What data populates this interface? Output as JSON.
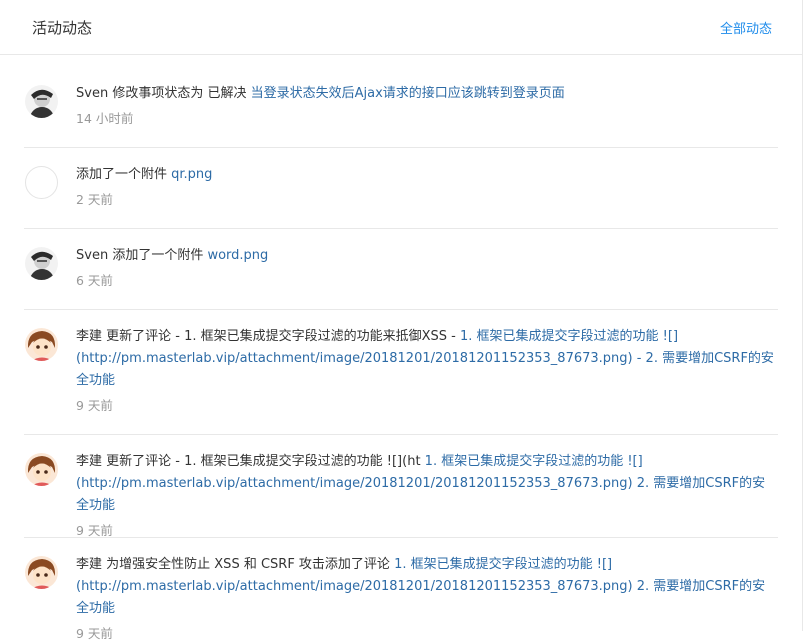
{
  "header": {
    "title": "活动动态",
    "all_link": "全部动态"
  },
  "activities": [
    {
      "actor": "Sven",
      "action": " 修改事项状态为 已解决 ",
      "target": "当登录状态失效后Ajax请求的接口应该跳转到登录页面",
      "time": "14 小时前",
      "avatar": "avatar-sven"
    },
    {
      "actor": "",
      "action": "添加了一个附件 ",
      "target": "qr.png",
      "time": "2 天前",
      "avatar": "avatar-empty"
    },
    {
      "actor": "Sven",
      "action": " 添加了一个附件 ",
      "target": "word.png",
      "time": "6 天前",
      "avatar": "avatar-sven"
    },
    {
      "actor": "李建",
      "action": " 更新了评论 - 1. 框架已集成提交字段过滤的功能来抵御XSS - ",
      "target": "1. 框架已集成提交字段过滤的功能 ![](http://pm.masterlab.vip/attachment/image/20181201/20181201152353_87673.png) - 2. 需要增加CSRF的安全功能",
      "time": "9 天前",
      "avatar": "avatar-lijian"
    },
    {
      "actor": "李建",
      "action": " 更新了评论 - 1. 框架已集成提交字段过滤的功能 ![](ht ",
      "target": "1. 框架已集成提交字段过滤的功能 ![](http://pm.masterlab.vip/attachment/image/20181201/20181201152353_87673.png) 2. 需要增加CSRF的安全功能",
      "time": "9 天前",
      "avatar": "avatar-lijian"
    },
    {
      "actor": "李建",
      "action": " 为增强安全性防止 XSS 和 CSRF 攻击添加了评论 ",
      "target": "1. 框架已集成提交字段过滤的功能 ![](http://pm.masterlab.vip/attachment/image/20181201/20181201152353_87673.png) 2. 需要增加CSRF的安全功能",
      "time": "9 天前",
      "avatar": "avatar-lijian"
    }
  ]
}
